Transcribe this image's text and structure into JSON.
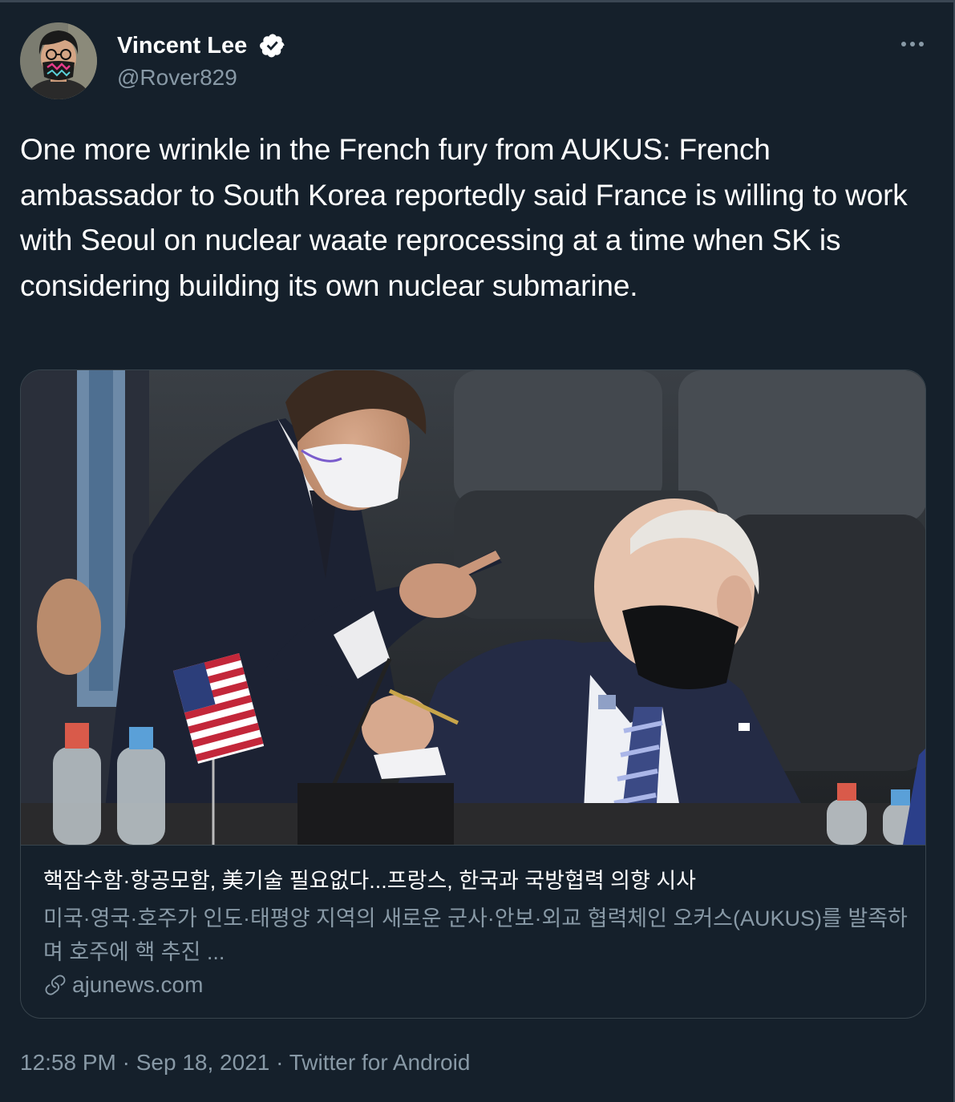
{
  "author": {
    "name": "Vincent Lee",
    "handle": "@Rover829",
    "verified": true
  },
  "tweet": {
    "text": "One more wrinkle in the French fury from AUKUS: French ambassador to South Korea reportedly said France is willing to work with Seoul on nuclear waate reprocessing at a time when SK is considering building its own nuclear submarine."
  },
  "card": {
    "title": "핵잠수함·항공모함, 美기술 필요없다...프랑스, 한국과 국방협력 의향 시사",
    "description": "미국·영국·호주가 인도·태평양 지역의 새로운 군사·안보·외교 협력체인 오커스(AUKUS)를 발족하며 호주에 핵 추진 ...",
    "domain": "ajunews.com"
  },
  "meta": {
    "time": "12:58 PM",
    "separator": " · ",
    "date": "Sep 18, 2021",
    "source": "Twitter for Android"
  },
  "icons": {
    "verified": "verified-badge-icon",
    "more": "more-options-icon",
    "link": "link-icon"
  },
  "colors": {
    "background": "#15202b",
    "text_primary": "#ffffff",
    "text_secondary": "#8899a6",
    "border": "#38444d"
  }
}
